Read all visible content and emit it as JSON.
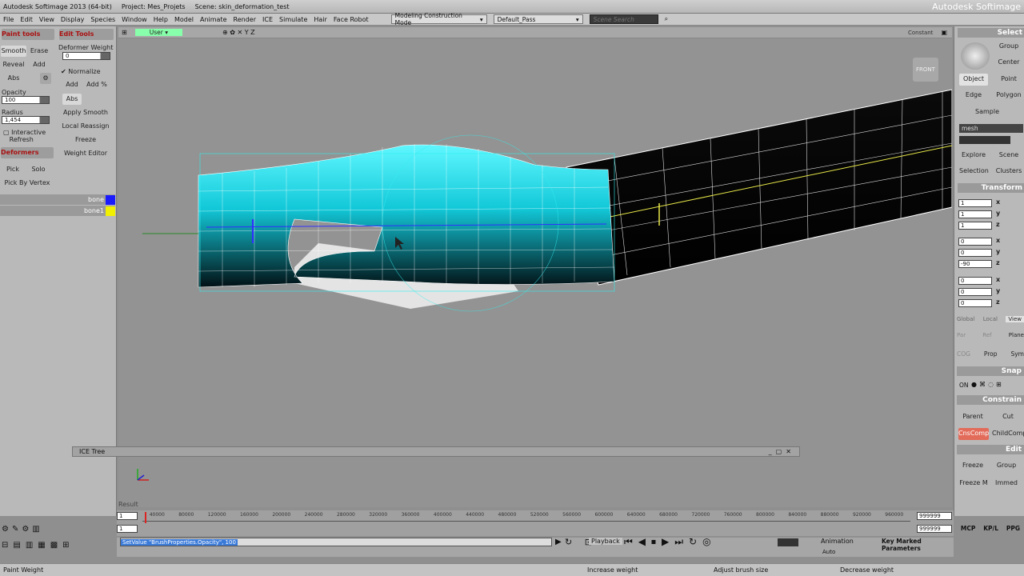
{
  "titlebar": {
    "app": "Autodesk Softimage 2013 (64-bit)",
    "project": "Project: Mes_Projets",
    "scene": "Scene: skin_deformation_test",
    "brand": "Autodesk Softimage"
  },
  "menu": [
    "File",
    "Edit",
    "View",
    "Display",
    "Species",
    "Window",
    "Help",
    "Model",
    "Animate",
    "Render",
    "ICE",
    "Simulate",
    "Hair",
    "Face Robot"
  ],
  "mode_combo": "Modeling Construction Mode",
  "pass_combo": "Default_Pass",
  "search_placeholder": "Scene Search",
  "left": {
    "tab1": "Paint tools",
    "tab2": "Edit Tools",
    "smooth": "Smooth",
    "erase": "Erase",
    "reveal": "Reveal",
    "add": "Add",
    "abs": "Abs",
    "deformer_weight": "Deformer Weight",
    "dw_value": "0",
    "normalize": "Normalize",
    "add2": "Add",
    "add_pct": "Add %",
    "opacity": "Opacity",
    "opacity_value": "100",
    "abs2": "Abs",
    "radius": "Radius",
    "radius_value": "1,454",
    "apply_smooth": "Apply Smooth",
    "interactive": "Interactive",
    "refresh": "Refresh",
    "local_reassign": "Local Reassign",
    "freeze": "Freeze",
    "deformers": "Deformers",
    "weight_editor": "Weight Editor",
    "pick": "Pick",
    "solo": "Solo",
    "pick_by_vertex": "Pick By Vertex",
    "bone0": "bone",
    "bone1": "bone1",
    "bone0_color": "#1a1aff",
    "bone1_color": "#f0f000"
  },
  "viewport": {
    "camera": "User",
    "front": "FRONT",
    "compass": "Constant"
  },
  "right": {
    "select": "Select",
    "group": "Group",
    "center": "Center",
    "object": "Object",
    "point": "Point",
    "edge": "Edge",
    "polygon": "Polygon",
    "sample": "Sample",
    "mesh": "mesh",
    "explore": "Explore",
    "scene": "Scene",
    "selection": "Selection",
    "clusters": "Clusters",
    "transform": "Transform",
    "s": [
      "1",
      "1",
      "1"
    ],
    "r": [
      "0",
      "0",
      "-90"
    ],
    "t": [
      "0",
      "0",
      "0"
    ],
    "global": "Global",
    "local": "Local",
    "view": "View",
    "par": "Par",
    "ref": "Ref",
    "plane": "Plane",
    "cog": "COG",
    "prop": "Prop",
    "sym": "Sym",
    "snap": "Snap",
    "on": "ON",
    "constrain": "Constrain",
    "parent": "Parent",
    "cut": "Cut",
    "cnscomp": "CnsComp",
    "childcomp": "ChildComp",
    "edit": "Edit",
    "freeze": "Freeze",
    "group2": "Group",
    "freeze_m": "Freeze M",
    "immed": "Immed",
    "mcp": "MCP",
    "kp": "KP/L",
    "ppg": "PPG"
  },
  "ice_tree": "ICE Tree",
  "result": "Result",
  "timeline": {
    "start": "1",
    "end": "999999",
    "ticks": [
      "40000",
      "80000",
      "120000",
      "160000",
      "200000",
      "240000",
      "280000",
      "320000",
      "360000",
      "400000",
      "440000",
      "480000",
      "520000",
      "560000",
      "600000",
      "640000",
      "680000",
      "720000",
      "760000",
      "800000",
      "840000",
      "880000",
      "920000",
      "960000"
    ]
  },
  "cmd": "SetValue \"BrushProperties.Opacity\", 100",
  "playback": "Playback",
  "animation": "Animation",
  "auto": "Auto",
  "key_marked": "Key Marked Parameters",
  "status": {
    "left": "Paint Weight",
    "mid1": "Increase weight",
    "mid2": "Adjust brush size",
    "right": "Decrease weight"
  }
}
